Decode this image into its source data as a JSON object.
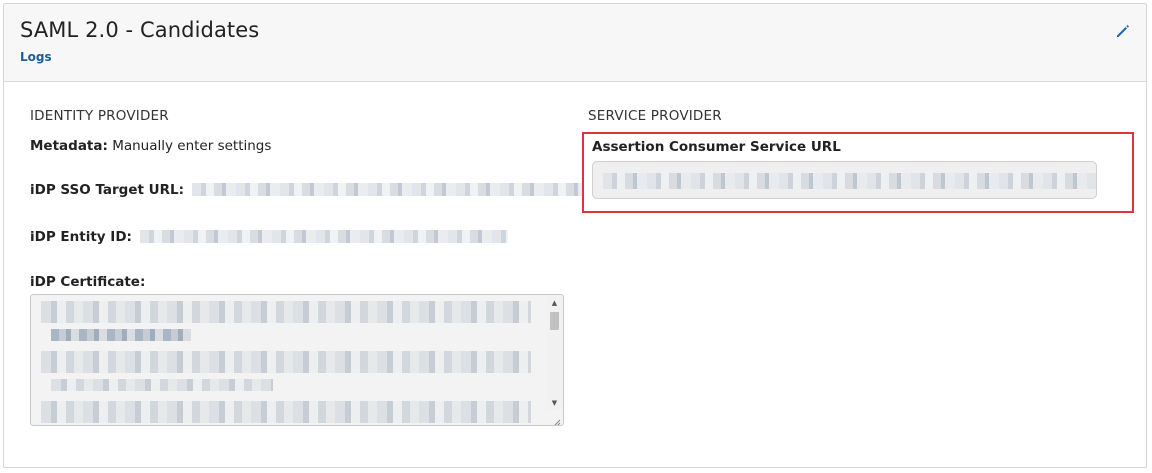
{
  "header": {
    "title": "SAML 2.0 - Candidates",
    "logs_link": "Logs",
    "edit_icon": "pencil-icon"
  },
  "identity_provider": {
    "heading": "IDENTITY PROVIDER",
    "metadata_label": "Metadata:",
    "metadata_value": "Manually enter settings",
    "sso_url_label": "iDP SSO Target URL:",
    "entity_id_label": "iDP Entity ID:",
    "certificate_label": "iDP Certificate:"
  },
  "service_provider": {
    "heading": "SERVICE PROVIDER",
    "acs_label": "Assertion Consumer Service URL"
  },
  "colors": {
    "link": "#1a5e9a",
    "highlight": "#e0343a",
    "header_bg": "#f7f7f7"
  }
}
